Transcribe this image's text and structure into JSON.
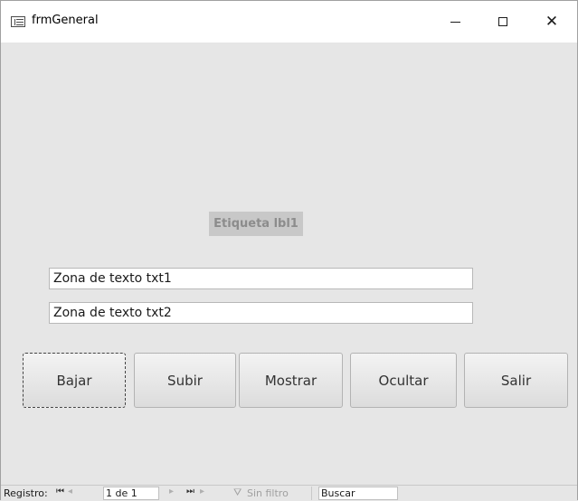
{
  "window": {
    "title": "frmGeneral",
    "icons": {
      "form": "form-view-icon",
      "minimize": "minimize-icon",
      "maximize": "maximize-icon",
      "close": "close-icon"
    }
  },
  "form": {
    "label_lbl1": "Etiqueta lbl1",
    "txt1_value": "Zona de texto txt1",
    "txt2_value": "Zona de texto txt2",
    "buttons": {
      "bajar": "Bajar",
      "subir": "Subir",
      "mostrar": "Mostrar",
      "ocultar": "Ocultar",
      "salir": "Salir"
    }
  },
  "navigation": {
    "label": "Registro:",
    "record": "1 de 1",
    "filter": "Sin filtro",
    "search_placeholder": "Buscar"
  },
  "colors": {
    "form_background": "#e6e6e6",
    "label_background": "#c8c8c8",
    "label_text": "#8c8c8c"
  }
}
